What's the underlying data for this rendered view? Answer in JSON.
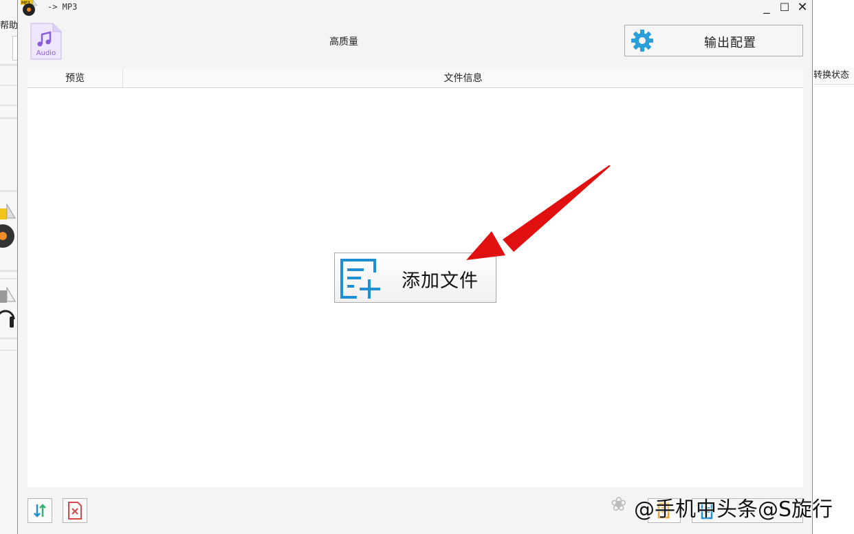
{
  "background_app": {
    "menu_help": "帮助",
    "column_header_status": "转换状态"
  },
  "window": {
    "title": "-> MP3",
    "icon_badge": "MP3",
    "controls": {
      "minimize": "_",
      "maximize": "☐",
      "close": "✕"
    }
  },
  "header": {
    "audio_icon_label": "Audio",
    "quality_label": "高质量",
    "output_config_label": "输出配置"
  },
  "table": {
    "columns": [
      "预览",
      "文件信息"
    ]
  },
  "main": {
    "add_file_label": "添加文件"
  },
  "watermark": {
    "text": "@手机中头条@S旋行"
  },
  "colors": {
    "accent_blue": "#1e8fd0",
    "audio_purple": "#8b5cd6",
    "delete_red": "#d94848",
    "arrow_red": "#e01010"
  }
}
